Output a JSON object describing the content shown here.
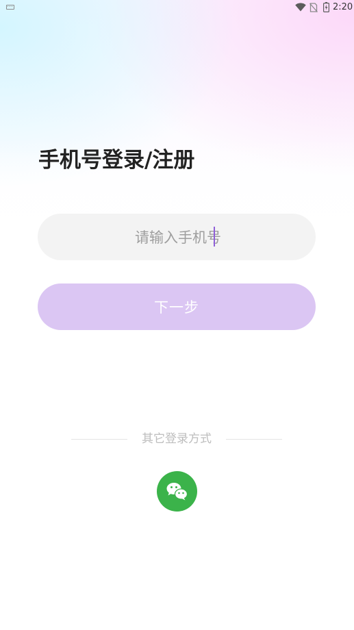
{
  "status_bar": {
    "time": "2:20",
    "icons": [
      "keyboard-icon",
      "wifi-icon",
      "no-sim-icon",
      "battery-icon"
    ]
  },
  "login": {
    "title": "手机号登录/注册",
    "phone_input": {
      "placeholder": "请输入手机号",
      "value": ""
    },
    "next_button_label": "下一步",
    "other_methods_label": "其它登录方式",
    "other_methods": [
      {
        "name": "wechat",
        "icon": "wechat-icon",
        "color": "#3bb34a"
      }
    ]
  },
  "colors": {
    "accent": "#dbc6f3",
    "caret": "#8f5fd8",
    "input_bg": "#f3f3f3",
    "wechat": "#3bb34a"
  }
}
